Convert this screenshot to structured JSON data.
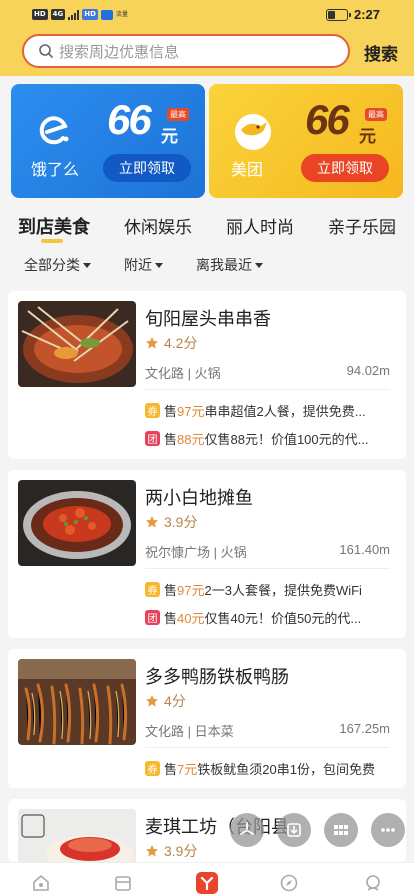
{
  "status_bar": {
    "left_chips": [
      "HD",
      "4G",
      "HD"
    ],
    "small_text": "流量",
    "time": "2:27",
    "battery_level": 0.35
  },
  "search": {
    "placeholder": "搜索周边优惠信息",
    "button_label": "搜索"
  },
  "promos": [
    {
      "brand": "饿了么",
      "amount": "66",
      "unit": "元",
      "max_tag": "最高",
      "claim_label": "立即领取",
      "icon": "eleme-logo-icon"
    },
    {
      "brand": "美团",
      "amount": "66",
      "unit": "元",
      "max_tag": "最高",
      "claim_label": "立即领取",
      "icon": "meituan-logo-icon"
    }
  ],
  "tabs": [
    {
      "label": "到店美食",
      "active": true
    },
    {
      "label": "休闲娱乐",
      "active": false
    },
    {
      "label": "丽人时尚",
      "active": false
    },
    {
      "label": "亲子乐园",
      "active": false
    }
  ],
  "filters": [
    {
      "label": "全部分类"
    },
    {
      "label": "附近"
    },
    {
      "label": "离我最近"
    }
  ],
  "stores": [
    {
      "name": "旬阳屋头串串香",
      "rating": "4.2分",
      "address": "文化路 | 火锅",
      "distance": "94.02m",
      "deals": [
        {
          "tag": "券",
          "type": "quan",
          "prefix": "售",
          "price": "97元",
          "text": " 串串超值2人餐，提供免费..."
        },
        {
          "tag": "团",
          "type": "tuan",
          "prefix": "售",
          "price": "88元",
          "text": " 仅售88元！价值100元的代..."
        }
      ]
    },
    {
      "name": "两小白地摊鱼",
      "rating": "3.9分",
      "address": "祝尔慷广场 | 火锅",
      "distance": "161.40m",
      "deals": [
        {
          "tag": "券",
          "type": "quan",
          "prefix": "售",
          "price": "97元",
          "text": " 2一3人套餐，提供免费WiFi"
        },
        {
          "tag": "团",
          "type": "tuan",
          "prefix": "售",
          "price": "40元",
          "text": " 仅售40元！价值50元的代..."
        }
      ]
    },
    {
      "name": "多多鸭肠铁板鸭肠",
      "rating": "4分",
      "address": "文化路 | 日本菜",
      "distance": "167.25m",
      "deals": [
        {
          "tag": "券",
          "type": "quan",
          "prefix": "售",
          "price": "7元",
          "text": " 铁板鱿鱼须20串1份，包间免费"
        }
      ]
    },
    {
      "name": "麦琪工坊（台阳县",
      "rating": "3.9分",
      "address": "",
      "distance": "",
      "deals": []
    }
  ],
  "floating_actions": [
    "pinwheel-icon",
    "download-icon",
    "grid-icon",
    "more-icon"
  ],
  "bottom_nav": [
    "home-icon",
    "store-icon",
    "brand-logo-icon",
    "compass-icon",
    "profile-icon"
  ],
  "colors": {
    "header_yellow": "#f7d35a",
    "search_border": "#e2603a",
    "ele_blue": "#1d73d6",
    "meituan_yellow": "#f5b81e",
    "price_orange": "#e0883a",
    "rating_gold": "#e29a3a"
  }
}
